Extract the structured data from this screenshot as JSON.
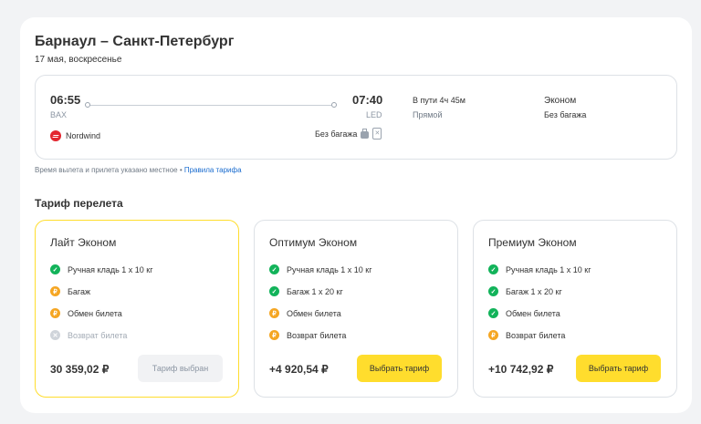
{
  "header": {
    "title": "Барнаул – Санкт-Петербург",
    "date": "17 мая, воскресенье"
  },
  "flight": {
    "departure_time": "06:55",
    "departure_code": "BAX",
    "arrival_time": "07:40",
    "arrival_code": "LED",
    "duration": "В пути 4ч 45м",
    "stops": "Прямой",
    "cabin": "Эконом",
    "baggage_summary": "Без багажа",
    "airline": "Nordwind",
    "baggage_label": "Без багажа"
  },
  "note": {
    "text": "Время вылета и прилета указано местное • ",
    "link": "Правила тарифа"
  },
  "section_title": "Тариф перелета",
  "tariffs": [
    {
      "name": "Лайт Эконом",
      "features": [
        {
          "label": "Ручная кладь 1 х 10 кг",
          "status": "included"
        },
        {
          "label": "Багаж",
          "status": "paid"
        },
        {
          "label": "Обмен билета",
          "status": "paid"
        },
        {
          "label": "Возврат билета",
          "status": "unavailable"
        }
      ],
      "price": "30 359,02 ₽",
      "button": "Тариф выбран"
    },
    {
      "name": "Оптимум Эконом",
      "features": [
        {
          "label": "Ручная кладь 1 х 10 кг",
          "status": "included"
        },
        {
          "label": "Багаж 1 х 20 кг",
          "status": "included"
        },
        {
          "label": "Обмен билета",
          "status": "paid"
        },
        {
          "label": "Возврат билета",
          "status": "paid"
        }
      ],
      "price": "+4 920,54 ₽",
      "button": "Выбрать тариф"
    },
    {
      "name": "Премиум Эконом",
      "features": [
        {
          "label": "Ручная кладь 1 х 10 кг",
          "status": "included"
        },
        {
          "label": "Багаж 1 х 20 кг",
          "status": "included"
        },
        {
          "label": "Обмен билета",
          "status": "included"
        },
        {
          "label": "Возврат билета",
          "status": "paid"
        }
      ],
      "price": "+10 742,92 ₽",
      "button": "Выбрать тариф"
    }
  ],
  "icons": {
    "check": "✓",
    "paid": "₽",
    "unavailable": "✕",
    "suitcase_x": "✕"
  },
  "colors": {
    "accent": "#ffdd2d",
    "included": "#12b35a",
    "paid": "#f5a623",
    "unavailable": "#cfd4da",
    "link": "#1a6ccf",
    "airline": "#e3262f"
  }
}
